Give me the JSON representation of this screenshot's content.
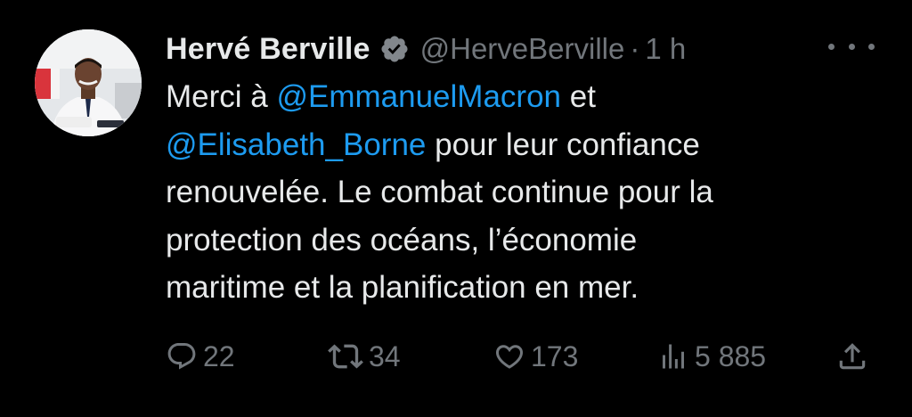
{
  "author": {
    "display_name": "Hervé Berville",
    "handle": "@HerveBerville",
    "separator": "·",
    "time": "1 h",
    "verified": true
  },
  "tweet": {
    "lines": [
      {
        "segments": [
          {
            "text": "Merci à ",
            "mention": false
          },
          {
            "text": "@EmmanuelMacron",
            "mention": true
          },
          {
            "text": " et",
            "mention": false
          }
        ]
      },
      {
        "segments": [
          {
            "text": "@Elisabeth_Borne",
            "mention": true
          },
          {
            "text": " pour leur confiance",
            "mention": false
          }
        ]
      },
      {
        "segments": [
          {
            "text": "renouvelée. Le combat continue pour la",
            "mention": false
          }
        ]
      },
      {
        "segments": [
          {
            "text": "protection des océans, l’économie",
            "mention": false
          }
        ]
      },
      {
        "segments": [
          {
            "text": "maritime et la planification en mer.",
            "mention": false
          }
        ]
      }
    ]
  },
  "actions": {
    "replies": "22",
    "reposts": "34",
    "likes": "173",
    "views": "5 885"
  },
  "icons": {
    "verified": "verified-badge-icon",
    "more": "more-icon",
    "reply": "reply-icon",
    "repost": "repost-icon",
    "like": "heart-icon",
    "views": "views-icon",
    "share": "share-icon"
  },
  "colors": {
    "background": "#000000",
    "text": "#e7e9ea",
    "secondary": "#71767b",
    "mention": "#1d9bf0"
  }
}
